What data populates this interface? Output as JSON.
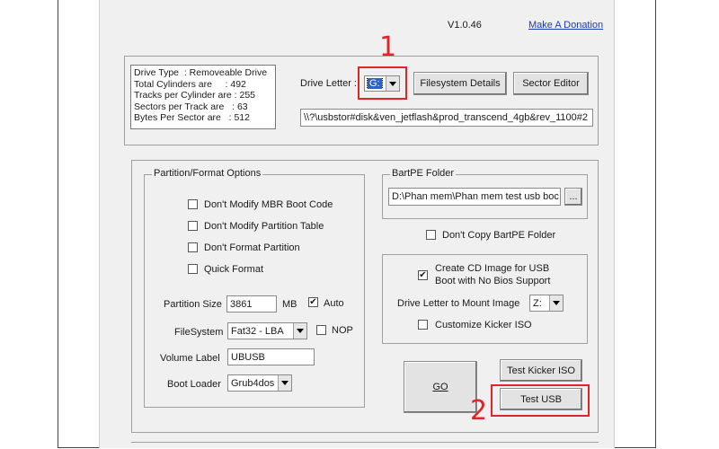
{
  "header": {
    "version": "V1.0.46",
    "donate_link": "Make A Donation"
  },
  "drive_info": {
    "lines": "Drive Type  : Removeable Drive\nTotal Cylinders are     : 492\nTracks per Cylinder are : 255\nSectors per Track are   : 63\nBytes Per Sector are   : 512"
  },
  "drive": {
    "letter_label": "Drive Letter :",
    "letter_value": "G:",
    "filesystem_details_button": "Filesystem Details",
    "sector_editor_button": "Sector Editor",
    "path": "\\\\?\\usbstor#disk&ven_jetflash&prod_transcend_4gb&rev_1100#2"
  },
  "partition": {
    "title": "Partition/Format Options",
    "options": [
      {
        "label": "Don't Modify MBR Boot Code",
        "checked": false
      },
      {
        "label": "Don't Modify Partition Table",
        "checked": false
      },
      {
        "label": "Don't Format Partition",
        "checked": false
      },
      {
        "label": "Quick Format",
        "checked": false
      }
    ],
    "size_label": "Partition Size",
    "size_value": "3861",
    "size_unit": "MB",
    "auto_label": "Auto",
    "auto_checked": true,
    "filesystem_label": "FileSystem",
    "filesystem_value": "Fat32 - LBA",
    "nop_label": "NOP",
    "nop_checked": false,
    "volume_label_label": "Volume Label",
    "volume_label_value": "UBUSB",
    "boot_loader_label": "Boot Loader",
    "boot_loader_value": "Grub4dos"
  },
  "bartpe": {
    "title": "BartPE Folder",
    "path": "D:\\Phan mem\\Phan mem test usb boc",
    "browse_label": "...",
    "dont_copy_label": "Don't Copy BartPE Folder",
    "dont_copy_checked": false
  },
  "cd_image": {
    "create_label_line1": "Create CD Image for USB",
    "create_label_line2": "Boot with No Bios Support",
    "create_checked": true,
    "mount_label": "Drive Letter to Mount Image",
    "mount_value": "Z:",
    "customize_label": "Customize Kicker ISO",
    "customize_checked": false
  },
  "actions": {
    "go_label": "GO",
    "test_kicker_label": "Test Kicker ISO",
    "test_usb_label": "Test USB"
  },
  "annotations": {
    "marker_1": "1",
    "marker_2": "2",
    "highlight_color": "#e0242a"
  }
}
